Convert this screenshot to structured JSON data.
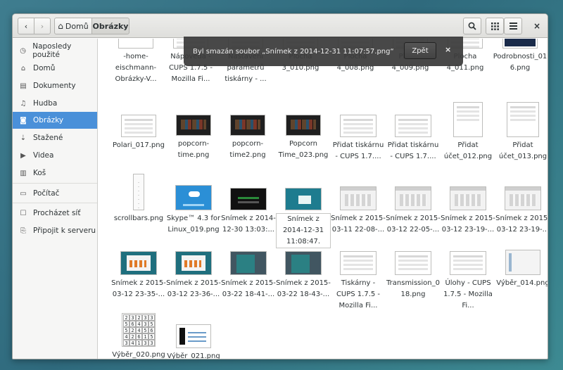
{
  "toolbar": {
    "back_label": "‹",
    "forward_label": "›",
    "home_label": "Domů",
    "current_label": "Obrázky",
    "search_icon": "search-icon",
    "view_icon": "grid-view-icon",
    "menu_icon": "hamburger-menu-icon",
    "close_label": "×"
  },
  "sidebar": {
    "items": [
      {
        "icon": "clock-icon",
        "glyph": "◷",
        "label": "Naposledy použité"
      },
      {
        "icon": "home-icon",
        "glyph": "⌂",
        "label": "Domů"
      },
      {
        "icon": "document-icon",
        "glyph": "▤",
        "label": "Dokumenty"
      },
      {
        "icon": "music-icon",
        "glyph": "♫",
        "label": "Hudba"
      },
      {
        "icon": "camera-icon",
        "glyph": "◙",
        "label": "Obrázky",
        "selected": true
      },
      {
        "icon": "download-icon",
        "glyph": "⇣",
        "label": "Stažené"
      },
      {
        "icon": "video-icon",
        "glyph": "▶",
        "label": "Videa"
      },
      {
        "icon": "trash-icon",
        "glyph": "🗑",
        "label": "Koš"
      },
      {
        "icon": "computer-icon",
        "glyph": "▭",
        "label": "Počítač"
      },
      {
        "icon": "network-icon",
        "glyph": "☐",
        "label": "Procházet síť"
      },
      {
        "icon": "server-icon",
        "glyph": "⎘",
        "label": "Připojit k serveru"
      }
    ]
  },
  "banner": {
    "message": "Byl smazán soubor „Snímek z 2014-12-31 11:07:57.png“",
    "undo_label": "Zpět",
    "close_label": "×"
  },
  "files": {
    "row0": [
      {
        "name": "-home-eischmann-Obrázky-V...",
        "thumb": "t-grid"
      },
      {
        "name": "Nápověda - CUPS 1.7.5 - Mozilla Fi...",
        "thumb": "t-doc"
      },
      {
        "name": "Nastavení parametrů tiskárny - ...",
        "thumb": "t-doc"
      },
      {
        "name": "Plocha 3_010.png",
        "thumb": "t-doc"
      },
      {
        "name": "Plocha 4_008.png",
        "thumb": "t-doc"
      },
      {
        "name": "Plocha 4_009.png",
        "thumb": "t-doc"
      },
      {
        "name": "Plocha 4_011.png",
        "thumb": "t-doc"
      },
      {
        "name": "Podrobnosti_016.png",
        "thumb": "t-navy"
      }
    ],
    "row1": [
      {
        "name": "Polari_017.png",
        "thumb": "t-doc"
      },
      {
        "name": "popcorn-time.png",
        "thumb": "t-dark"
      },
      {
        "name": "popcorn-time2.png",
        "thumb": "t-dark"
      },
      {
        "name": "Popcorn Time_023.png",
        "thumb": "t-dark"
      },
      {
        "name": "Přidat tiskárnu - CUPS 1.7....",
        "thumb": "t-doc"
      },
      {
        "name": "Přidat tiskárnu - CUPS 1.7....",
        "thumb": "t-doc"
      },
      {
        "name": "Přidat účet_012.png",
        "thumb": "t-doc"
      },
      {
        "name": "Přidat účet_013.png",
        "thumb": "t-doc"
      }
    ],
    "row2": [
      {
        "name": "scrollbars.png",
        "thumb": "t-tall"
      },
      {
        "name": "Skype™ 4.3 for Linux_019.png",
        "thumb": "t-blue"
      },
      {
        "name": "Snímek z 2014-12-30 13:03:...",
        "thumb": "t-black"
      },
      {
        "name": "Snímek z 2014-12-31 11:08:47.",
        "thumb": "t-teal",
        "selected": true
      },
      {
        "name": "Snímek z 2015-03-11 22-08-...",
        "thumb": "t-win"
      },
      {
        "name": "Snímek z 2015-03-12 22-05-...",
        "thumb": "t-win"
      },
      {
        "name": "Snímek z 2015-03-12 23-19-...",
        "thumb": "t-win"
      },
      {
        "name": "Snímek z 2015-03-12 23-19-...",
        "thumb": "t-win"
      }
    ],
    "row3": [
      {
        "name": "Snímek z 2015-03-12 23-35-...",
        "thumb": "t-teal2"
      },
      {
        "name": "Snímek z 2015-03-12 23-36-...",
        "thumb": "t-teal2"
      },
      {
        "name": "Snímek z 2015-03-22 18-41-...",
        "thumb": "t-slate"
      },
      {
        "name": "Snímek z 2015-03-22 18-43-...",
        "thumb": "t-slate"
      },
      {
        "name": "Tiskárny - CUPS 1.7.5 - Mozilla Fi...",
        "thumb": "t-doc"
      },
      {
        "name": "Transmission_018.png",
        "thumb": "t-doc"
      },
      {
        "name": "Úlohy - CUPS 1.7.5 - Mozilla Fi...",
        "thumb": "t-doc"
      },
      {
        "name": "Výběr_014.png",
        "thumb": "t-bar"
      }
    ],
    "row4": [
      {
        "name": "Výběr_020.png",
        "thumb": "t-sudoku"
      },
      {
        "name": "Výběr_021.png",
        "thumb": "t-strip"
      }
    ],
    "sudoku": [
      "2",
      "3",
      "2",
      "3",
      "3",
      "5",
      "6",
      "4",
      "3",
      "5",
      "5",
      "2",
      "4",
      "5",
      "6",
      "4",
      "2",
      "6",
      "1",
      "5",
      "3",
      "4",
      "1",
      "3",
      "3"
    ]
  }
}
